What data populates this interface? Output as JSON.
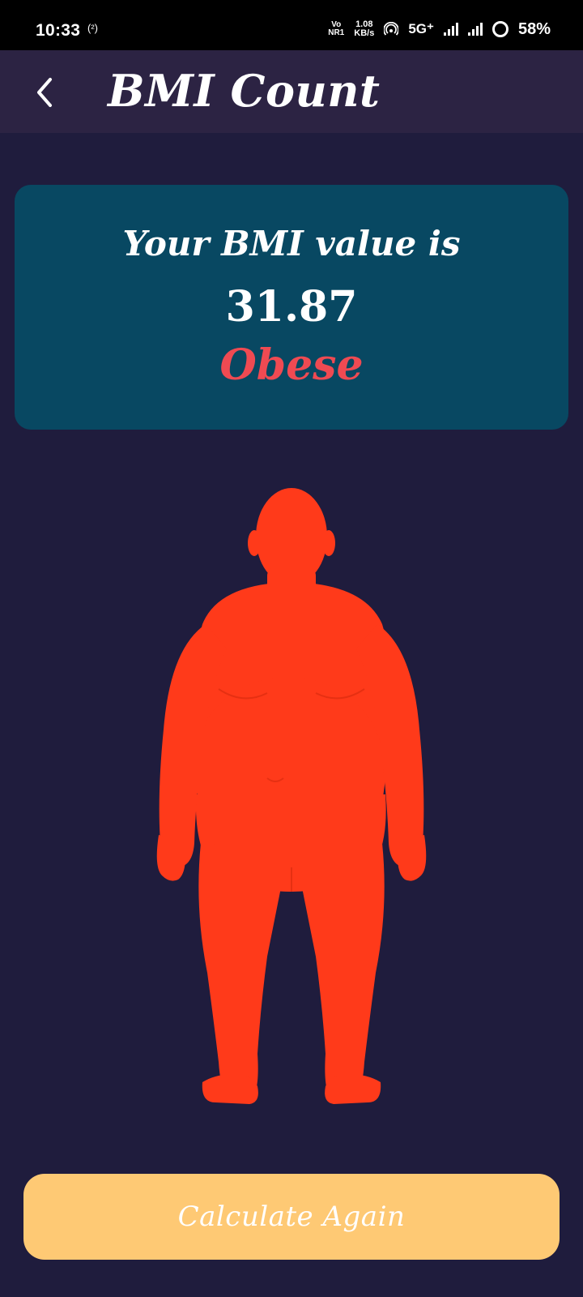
{
  "status_bar": {
    "time": "10:33",
    "cast_indicator": "(²)",
    "volte_top": "Vo",
    "volte_bottom": "NR1",
    "speed_value": "1.08",
    "speed_unit": "KB/s",
    "network_type": "5G⁺",
    "battery_percent": "58%",
    "icons": [
      "cast-icon",
      "hotspot-icon",
      "signal-icon",
      "battery-icon"
    ]
  },
  "app_bar": {
    "title": "BMI Count",
    "back_icon": "chevron-left-icon"
  },
  "result": {
    "label": "Your BMI value is",
    "value": "31.87",
    "category": "Obese",
    "category_color": "#ef4a52"
  },
  "figure": {
    "description_icon": "body-figure-icon",
    "color": "#ff3a1a"
  },
  "actions": {
    "calculate_again_label": "Calculate Again"
  },
  "colors": {
    "background": "#1f1c3d",
    "app_bar": "#2c2343",
    "card": "#084862",
    "button": "#fec974"
  }
}
